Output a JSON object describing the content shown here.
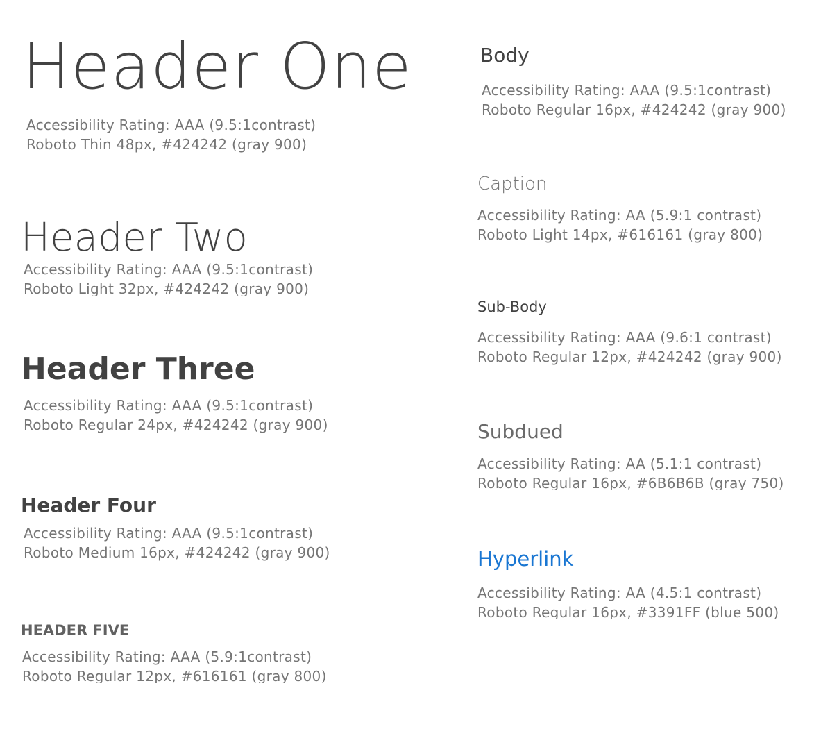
{
  "left_column": {
    "h1": {
      "title": "Header One",
      "rating": "Accessibility Rating: AAA (9.5:1contrast)",
      "spec": "Roboto Thin 48px, #424242 (gray 900)"
    },
    "h2": {
      "title": "Header Two",
      "rating": "Accessibility Rating: AAA (9.5:1contrast)",
      "spec": "Roboto Light 32px, #424242 (gray 900)"
    },
    "h3": {
      "title": "Header Three",
      "rating": "Accessibility Rating: AAA (9.5:1contrast)",
      "spec": "Roboto Regular 24px, #424242 (gray 900)"
    },
    "h4": {
      "title": "Header Four",
      "rating": "Accessibility Rating: AAA (9.5:1contrast)",
      "spec": "Roboto Medium 16px, #424242 (gray 900)"
    },
    "h5": {
      "title": "HEADER FIVE",
      "rating": "Accessibility Rating: AAA (5.9:1contrast)",
      "spec": "Roboto Regular 12px, #616161 (gray 800)"
    }
  },
  "right_column": {
    "body": {
      "title": "Body",
      "rating": "Accessibility Rating: AAA (9.5:1contrast)",
      "spec": "Roboto Regular 16px, #424242 (gray 900)"
    },
    "caption": {
      "title": "Caption",
      "rating": "Accessibility Rating: AA (5.9:1 contrast)",
      "spec": "Roboto Light 14px, #616161 (gray 800)"
    },
    "subbody": {
      "title": "Sub-Body",
      "rating": "Accessibility Rating: AAA (9.6:1 contrast)",
      "spec": "Roboto Regular 12px, #424242 (gray 900)"
    },
    "subdued": {
      "title": "Subdued",
      "rating": "Accessibility Rating: AA (5.1:1 contrast)",
      "spec": "Roboto Regular 16px, #6B6B6B (gray 750)"
    },
    "hyperlink": {
      "title": "Hyperlink",
      "rating": "Accessibility Rating: AA (4.5:1 contrast)",
      "spec": "Roboto Regular 16px, #3391FF (blue 500)"
    }
  },
  "colors": {
    "gray_900": "#424242",
    "gray_800": "#616161",
    "gray_750": "#6B6B6B",
    "link_blue": "#1976D2",
    "description_gray": "#757575"
  }
}
